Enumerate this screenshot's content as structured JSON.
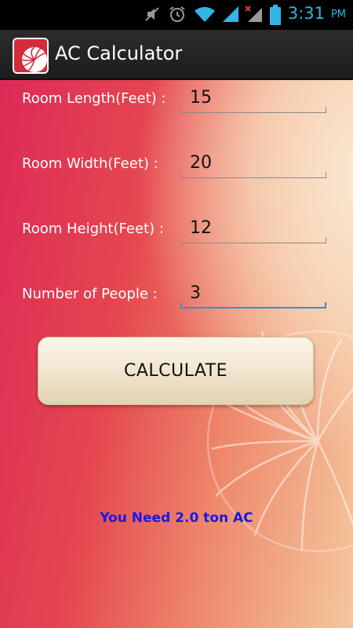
{
  "status_bar": {
    "time": "3:31",
    "ampm": "PM",
    "icons": [
      "mute-icon",
      "alarm-icon",
      "wifi-icon",
      "signal-icon",
      "no-signal-icon",
      "battery-icon"
    ]
  },
  "app": {
    "title": "AC Calculator",
    "icon": "app-logo-icon"
  },
  "form": {
    "fields": [
      {
        "label": "Room Length(Feet) :",
        "value": "15"
      },
      {
        "label": "Room Width(Feet) :",
        "value": "20"
      },
      {
        "label": "Room Height(Feet) :",
        "value": "12"
      },
      {
        "label": "Number of People :",
        "value": "3"
      }
    ],
    "focused_index": 3
  },
  "button": {
    "label": "CALCULATE"
  },
  "result": {
    "text": "You Need 2.0 ton AC"
  },
  "colors": {
    "accent": "#33b5e5",
    "result_text": "#1a18e6",
    "focus_underline": "#2f8fe0"
  }
}
